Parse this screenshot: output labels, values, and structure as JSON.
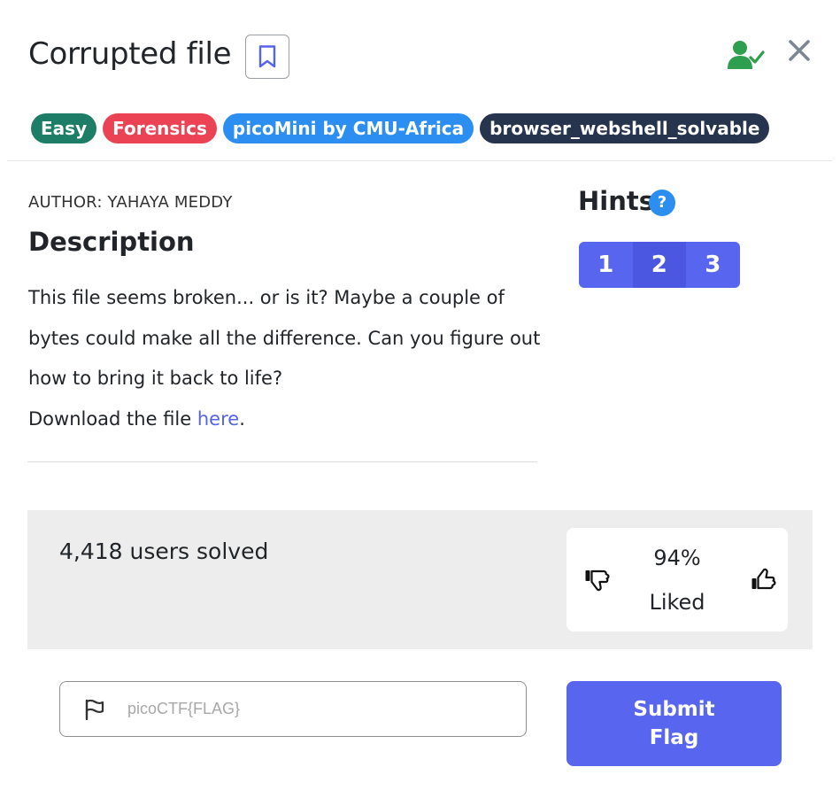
{
  "challenge": {
    "title": "Corrupted file",
    "tags": [
      {
        "label": "Easy",
        "color": "#1e7d66"
      },
      {
        "label": "Forensics",
        "color": "#eb4354"
      },
      {
        "label": "picoMini by CMU-Africa",
        "color": "#2b8ef0"
      },
      {
        "label": "browser_webshell_solvable",
        "color": "#27344d"
      }
    ],
    "author": "AUTHOR: YAHAYA MEDDY",
    "description_heading": "Description",
    "description_text": "This file seems broken... or is it? Maybe a couple of bytes could make all the difference. Can you figure out how to bring it back to life?",
    "download_prefix": "Download the file ",
    "download_link": "here",
    "download_suffix": "."
  },
  "hints": {
    "heading": "Hints",
    "help_glyph": "?",
    "buttons": [
      "1",
      "2",
      "3"
    ]
  },
  "stats": {
    "solved": "4,418 users solved",
    "liked_percent": "94%",
    "liked_label": "Liked"
  },
  "flag": {
    "placeholder": "picoCTF{FLAG}",
    "value": "",
    "submit_label": "Submit Flag"
  },
  "icons": {
    "bookmark": "bookmark-icon",
    "user_check": "user-check-icon",
    "close": "close-icon",
    "flag": "flag-icon",
    "thumbs_down": "thumbs-down-icon",
    "thumbs_up": "thumbs-up-icon"
  },
  "colors": {
    "accent": "#5865ef",
    "link": "#5563e8",
    "success": "#2e9e4f"
  }
}
